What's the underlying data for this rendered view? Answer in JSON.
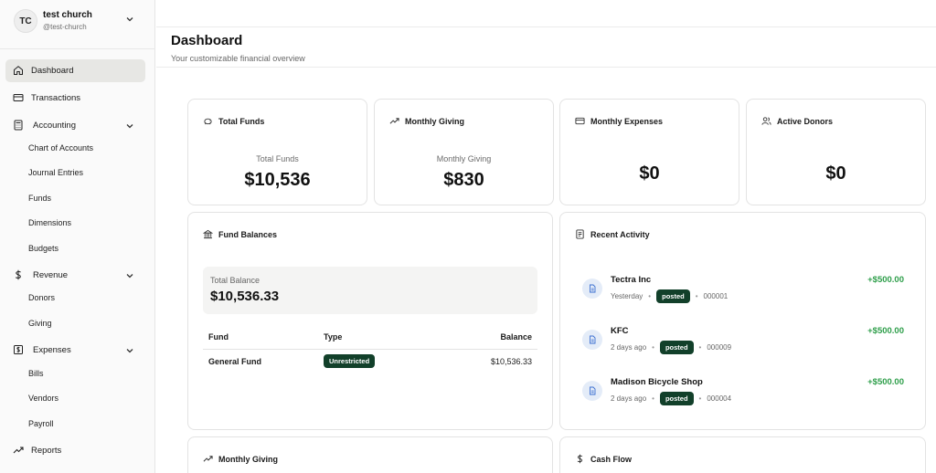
{
  "org": {
    "initials": "TC",
    "name": "test church",
    "handle": "@test-church"
  },
  "sidebar": {
    "dashboard": "Dashboard",
    "transactions": "Transactions",
    "accounting": "Accounting",
    "accounting_items": [
      "Chart of Accounts",
      "Journal Entries",
      "Funds",
      "Dimensions",
      "Budgets"
    ],
    "revenue": "Revenue",
    "revenue_items": [
      "Donors",
      "Giving"
    ],
    "expenses": "Expenses",
    "expenses_items": [
      "Bills",
      "Vendors",
      "Payroll"
    ],
    "reports": "Reports"
  },
  "header": {
    "title": "Dashboard",
    "subtitle": "Your customizable financial overview"
  },
  "stats": {
    "total_funds": {
      "title": "Total Funds",
      "label": "Total Funds",
      "value": "$10,536"
    },
    "monthly_giving": {
      "title": "Monthly Giving",
      "label": "Monthly Giving",
      "value": "$830"
    },
    "monthly_expenses": {
      "title": "Monthly Expenses",
      "value": "$0"
    },
    "active_donors": {
      "title": "Active Donors",
      "value": "$0"
    }
  },
  "fund_balances": {
    "title": "Fund Balances",
    "total_label": "Total Balance",
    "total_value": "$10,536.33",
    "columns": [
      "Fund",
      "Type",
      "Balance"
    ],
    "rows": [
      {
        "fund": "General Fund",
        "type": "Unrestricted",
        "balance": "$10,536.33"
      }
    ]
  },
  "recent_activity": {
    "title": "Recent Activity",
    "items": [
      {
        "name": "Tectra Inc",
        "when": "Yesterday",
        "status": "posted",
        "ref": "000001",
        "amount": "+$500.00"
      },
      {
        "name": "KFC",
        "when": "2 days ago",
        "status": "posted",
        "ref": "000009",
        "amount": "+$500.00"
      },
      {
        "name": "Madison Bicycle Shop",
        "when": "2 days ago",
        "status": "posted",
        "ref": "000004",
        "amount": "+$500.00"
      }
    ]
  },
  "bottom": {
    "monthly_giving": "Monthly Giving",
    "cash_flow": "Cash Flow"
  },
  "colors": {
    "positive": "#2e9e4a",
    "badge": "#12402a",
    "active_nav": "#e7e7e4"
  }
}
